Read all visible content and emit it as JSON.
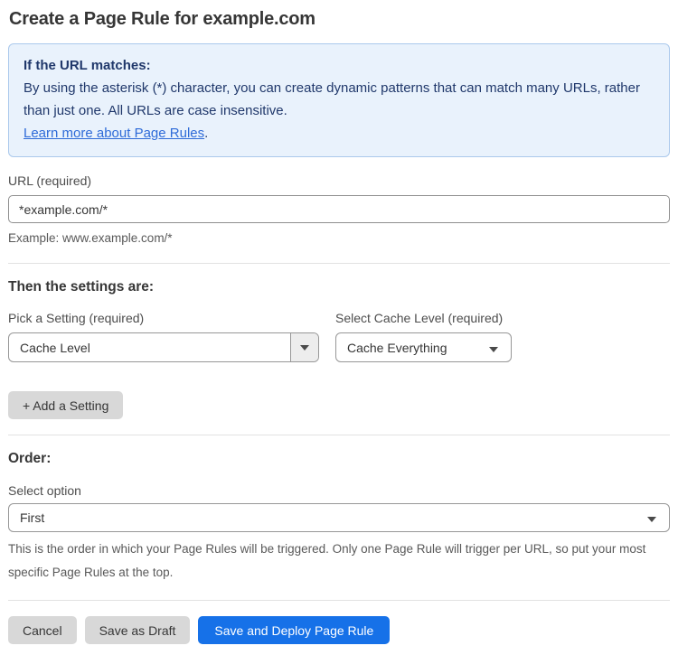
{
  "page": {
    "title": "Create a Page Rule for example.com"
  },
  "info_box": {
    "heading": "If the URL matches:",
    "body": "By using the asterisk (*) character, you can create dynamic patterns that can match many URLs, rather than just one. All URLs are case insensitive.",
    "link_label": "Learn more about Page Rules",
    "link_suffix": "."
  },
  "url_field": {
    "label": "URL (required)",
    "value": "*example.com/*",
    "helper": "Example: www.example.com/*"
  },
  "settings_section": {
    "heading": "Then the settings are:",
    "setting_select": {
      "label": "Pick a Setting (required)",
      "value": "Cache Level"
    },
    "cache_level_select": {
      "label": "Select Cache Level (required)",
      "value": "Cache Everything"
    },
    "add_setting_label": "+ Add a Setting"
  },
  "order_section": {
    "heading": "Order:",
    "label": "Select option",
    "value": "First",
    "helper": "This is the order in which your Page Rules will be triggered. Only one Page Rule will trigger per URL, so put your most specific Page Rules at the top."
  },
  "actions": {
    "cancel_label": "Cancel",
    "save_draft_label": "Save as Draft",
    "save_deploy_label": "Save and Deploy Page Rule"
  },
  "colors": {
    "primary_blue": "#1671e8",
    "info_background": "#e9f2fc",
    "info_border": "#abc9ec",
    "info_text": "#20386b",
    "link_blue": "#2e6bd8",
    "button_gray": "#d8d8d8"
  }
}
